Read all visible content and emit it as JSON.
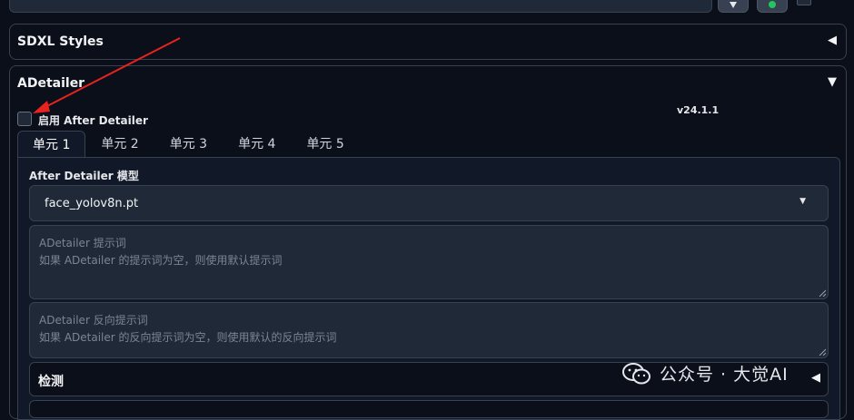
{
  "sdxl_styles": {
    "title": "SDXL Styles"
  },
  "adetailer": {
    "title": "ADetailer",
    "enable_label": "启用 After Detailer",
    "version": "v24.1.1",
    "tabs": [
      {
        "label": "单元 1",
        "active": true
      },
      {
        "label": "单元 2",
        "active": false
      },
      {
        "label": "单元 3",
        "active": false
      },
      {
        "label": "单元 4",
        "active": false
      },
      {
        "label": "单元 5",
        "active": false
      }
    ],
    "model_label": "After Detailer 模型",
    "model_value": "face_yolov8n.pt",
    "prompt": {
      "line1": "ADetailer 提示词",
      "line2": "如果 ADetailer 的提示词为空，则使用默认提示词"
    },
    "negative_prompt": {
      "line1": "ADetailer 反向提示词",
      "line2": "如果 ADetailer 的反向提示词为空，则使用默认的反向提示词"
    },
    "detection_label": "检测"
  },
  "watermark": {
    "text": "公众号 · 大觉AI"
  },
  "colors": {
    "arrow": "#e8231f",
    "panel_bg": "#111827",
    "page_bg": "#0b0f19",
    "border": "#374151"
  },
  "icons": [
    "triangle-left-icon",
    "triangle-down-icon",
    "chevron-down-icon",
    "wechat-icon"
  ]
}
